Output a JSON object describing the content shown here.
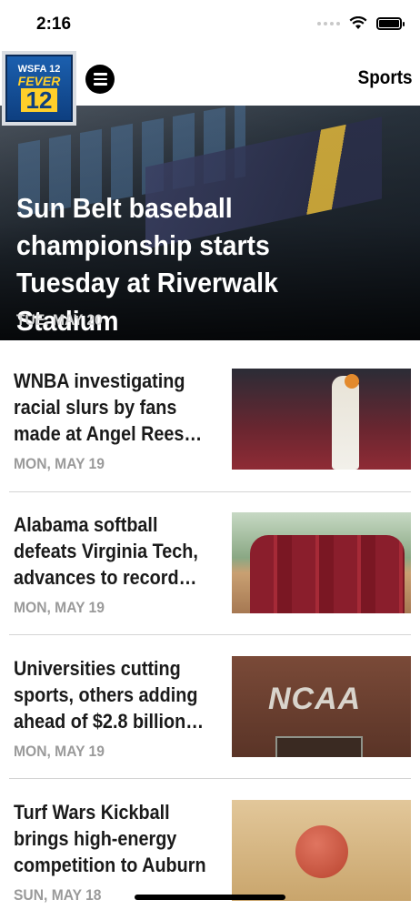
{
  "status_bar": {
    "time": "2:16"
  },
  "header": {
    "logo": {
      "top": "WSFA 12",
      "middle": "FEVER",
      "number": "12"
    },
    "section": "Sports"
  },
  "hero": {
    "title": "Sun Belt baseball championship starts Tuesday at Riverwalk Stadium",
    "date": "TUE, MAY 20"
  },
  "articles": [
    {
      "title": "WNBA investigating racial slurs by fans made at Angel Rees…",
      "date": "MON, MAY 19"
    },
    {
      "title": "Alabama softball defeats Virginia Tech, advances to record…",
      "date": "MON, MAY 19"
    },
    {
      "title": "Universities cutting sports, others adding ahead of $2.8 billion…",
      "date": "MON, MAY 19",
      "thumb_text": "NCAA"
    },
    {
      "title": "Turf Wars Kickball brings high-energy competition to Auburn",
      "date": "SUN, MAY 18"
    }
  ]
}
